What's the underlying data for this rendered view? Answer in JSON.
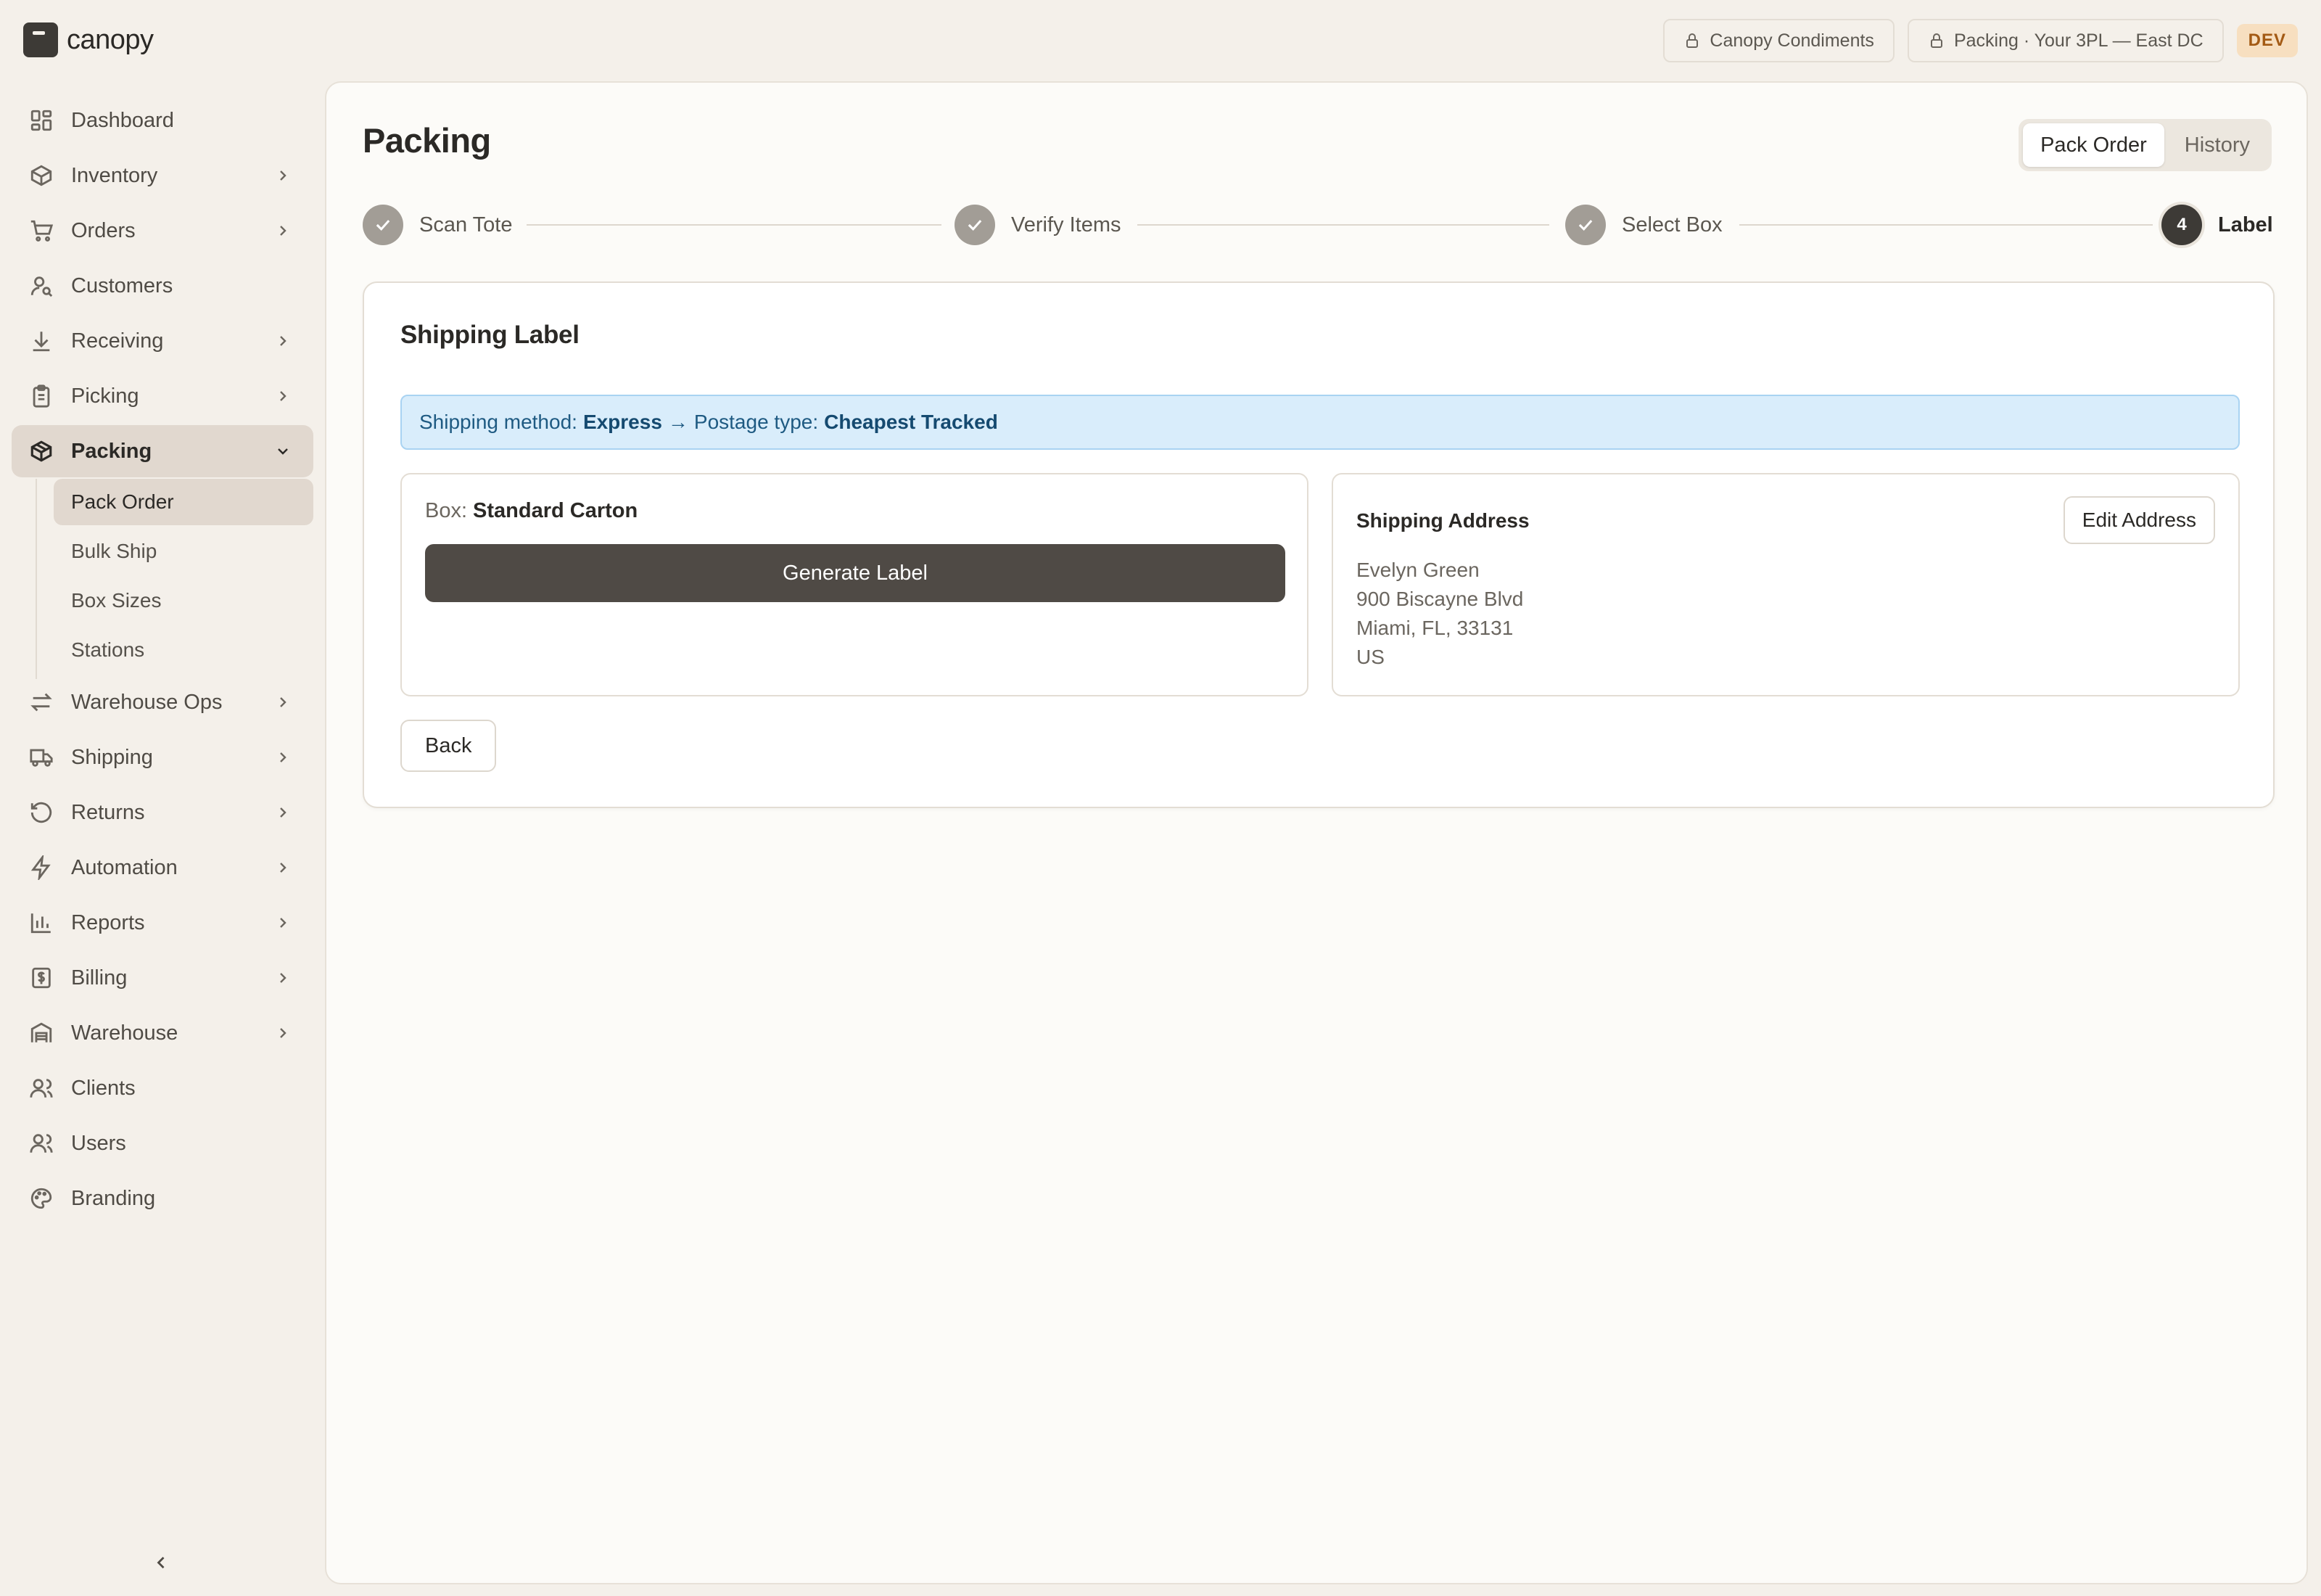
{
  "app": {
    "name": "canopy"
  },
  "topbar": {
    "client": "Canopy Condiments",
    "station": "Packing · Your 3PL — East DC",
    "env_badge": "DEV"
  },
  "sidebar": {
    "items": [
      {
        "label": "Dashboard",
        "icon": "dashboard-icon"
      },
      {
        "label": "Inventory",
        "icon": "box-icon"
      },
      {
        "label": "Orders",
        "icon": "cart-icon"
      },
      {
        "label": "Customers",
        "icon": "customer-icon"
      },
      {
        "label": "Receiving",
        "icon": "download-icon"
      },
      {
        "label": "Picking",
        "icon": "clipboard-icon"
      },
      {
        "label": "Packing",
        "icon": "package-icon"
      },
      {
        "label": "Warehouse Ops",
        "icon": "arrows-icon"
      },
      {
        "label": "Shipping",
        "icon": "truck-icon"
      },
      {
        "label": "Returns",
        "icon": "returns-icon"
      },
      {
        "label": "Automation",
        "icon": "bolt-icon"
      },
      {
        "label": "Reports",
        "icon": "bar-chart-icon"
      },
      {
        "label": "Billing",
        "icon": "billing-icon"
      },
      {
        "label": "Warehouse",
        "icon": "warehouse-icon"
      },
      {
        "label": "Clients",
        "icon": "clients-icon"
      },
      {
        "label": "Users",
        "icon": "users-icon"
      },
      {
        "label": "Branding",
        "icon": "palette-icon"
      }
    ],
    "packing_sub": [
      "Pack Order",
      "Bulk Ship",
      "Box Sizes",
      "Stations"
    ]
  },
  "page": {
    "title": "Packing",
    "tabs": [
      "Pack Order",
      "History"
    ]
  },
  "stepper": {
    "steps": [
      "Scan Tote",
      "Verify Items",
      "Select Box",
      "Label"
    ],
    "current_number": "4"
  },
  "label_panel": {
    "title": "Shipping Label",
    "method_prefix": "Shipping method:",
    "method_value": "Express",
    "arrow": "→",
    "postage_prefix": "Postage type:",
    "postage_value": "Cheapest Tracked",
    "box_prefix": "Box:",
    "box_value": "Standard Carton",
    "generate_label": "Generate Label",
    "address_title": "Shipping Address",
    "edit_address": "Edit Address",
    "address_lines": [
      "Evelyn Green",
      "900 Biscayne Blvd",
      "Miami, FL, 33131",
      "US"
    ],
    "back": "Back"
  },
  "colors": {
    "accent_dark": "#3d3a36",
    "info_bg": "#d9edfb",
    "info_text": "#1e5a82",
    "dev_badge": "#f7dfc0"
  }
}
